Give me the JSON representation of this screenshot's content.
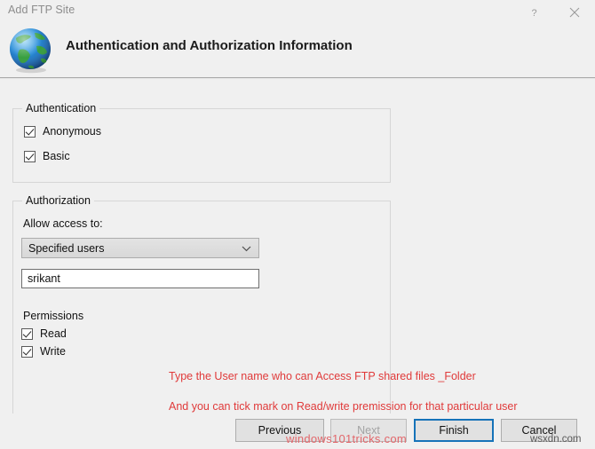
{
  "window": {
    "title": "Add FTP Site",
    "help_icon": "question-mark-icon",
    "close_icon": "close-icon"
  },
  "header": {
    "icon": "globe-icon",
    "title": "Authentication and Authorization Information"
  },
  "authentication": {
    "group_title": "Authentication",
    "options": [
      {
        "label": "Anonymous",
        "checked": true
      },
      {
        "label": "Basic",
        "checked": true
      }
    ]
  },
  "authorization": {
    "group_title": "Authorization",
    "allow_access_label": "Allow access to:",
    "access_select": {
      "value": "Specified users",
      "arrow_icon": "chevron-down-icon"
    },
    "users_field": {
      "value": "srikant",
      "placeholder": ""
    },
    "permissions_label": "Permissions",
    "permissions": [
      {
        "label": "Read",
        "checked": true
      },
      {
        "label": "Write",
        "checked": true
      }
    ]
  },
  "annotations": [
    "Type the User name who can Access FTP shared files _Folder",
    "And you can tick mark on Read/write premission for that particular user"
  ],
  "footer": {
    "buttons": [
      {
        "label": "Previous",
        "state": "enabled"
      },
      {
        "label": "Next",
        "state": "disabled"
      },
      {
        "label": "Finish",
        "state": "default"
      },
      {
        "label": "Cancel",
        "state": "enabled"
      }
    ]
  },
  "watermarks": {
    "main": "windows101tricks.com",
    "corner": "wsxdn.com"
  },
  "colors": {
    "dialog_background": "#f0f0f0",
    "annotation_red": "#e03a3a",
    "default_button_border": "#1673b9",
    "title_gray": "#8d8d8d"
  }
}
